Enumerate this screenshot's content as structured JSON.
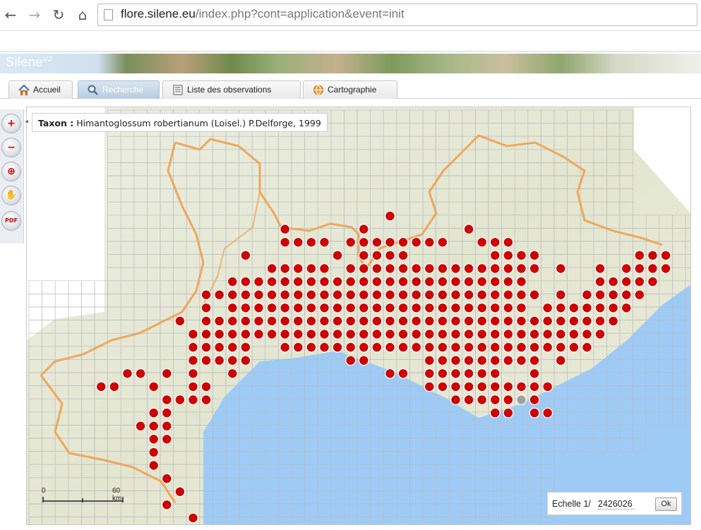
{
  "browser": {
    "url_domain": "flore.silene.eu",
    "url_path": "/index.php?cont=application&event=init",
    "back_icon": "arrow-left-icon",
    "forward_icon": "arrow-right-icon",
    "reload_icon": "reload-icon",
    "home_icon": "home-icon"
  },
  "app": {
    "logo_text": "Silene",
    "logo_version": "V2"
  },
  "tabs": [
    {
      "label": "Accueil",
      "icon": "home-icon",
      "active": false
    },
    {
      "label": "Recherche",
      "icon": "magnifier-icon",
      "active": true
    },
    {
      "label": "Liste des observations",
      "icon": "list-icon",
      "active": false
    },
    {
      "label": "Cartographie",
      "icon": "globe-icon",
      "active": false
    }
  ],
  "toolbar": {
    "tools": [
      {
        "name": "zoom-in",
        "icon": "zoom-in-icon",
        "glyph": "+"
      },
      {
        "name": "zoom-out",
        "icon": "zoom-out-icon",
        "glyph": "−"
      },
      {
        "name": "zoom-box",
        "icon": "zoom-box-icon",
        "glyph": "⊕"
      },
      {
        "name": "pan",
        "icon": "hand-icon",
        "glyph": "✋"
      },
      {
        "name": "pdf-export",
        "icon": "pdf-icon",
        "glyph": "PDF"
      }
    ]
  },
  "map": {
    "taxon_label": "Taxon :",
    "taxon_name": "Himantoglossum robertianum (Loisel.) P.Delforge, 1999",
    "scale_start": "0",
    "scale_end": "60 km",
    "echelle_label": "Echelle 1/",
    "echelle_value": "2426026",
    "ok_label": "Ok",
    "colors": {
      "sea": "#9ecbf5",
      "land": "#e9ead8",
      "grid": "#b9bcc4",
      "border": "#f0a050",
      "dot_red": "#cc0000",
      "dot_grey": "#a0a0a0"
    }
  }
}
